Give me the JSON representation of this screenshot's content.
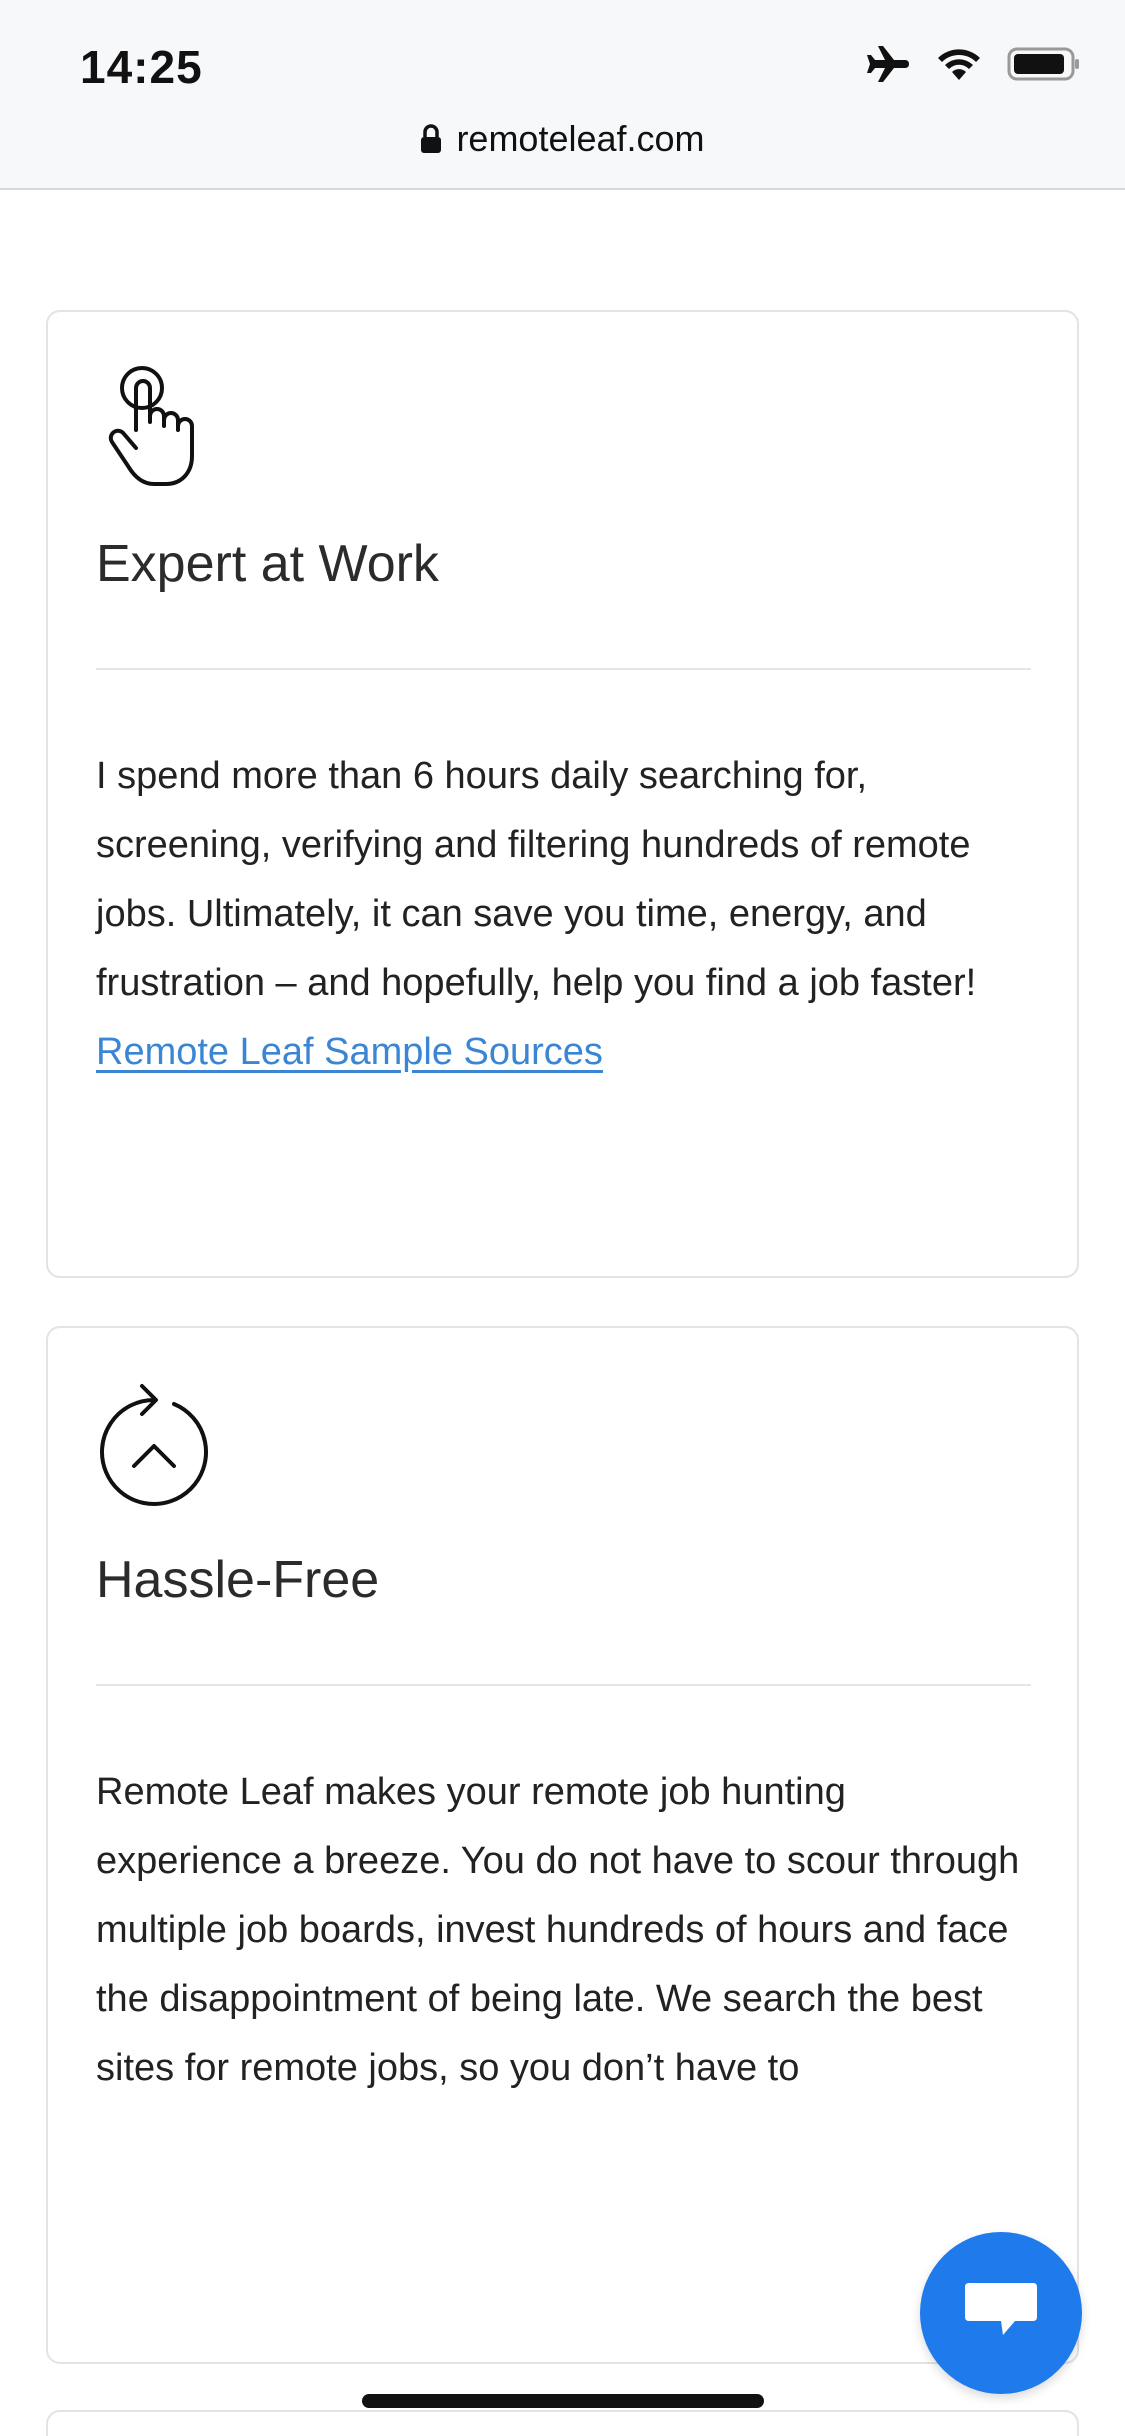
{
  "status_bar": {
    "time": "14:25",
    "icons": [
      "airplane-icon",
      "wifi-icon",
      "battery-icon"
    ]
  },
  "url_bar": {
    "domain": "remoteleaf.com",
    "icon": "lock-icon"
  },
  "cards": [
    {
      "icon": "pointer-hand-icon",
      "title": "Expert at Work",
      "body": "I spend more than 6 hours daily searching for, screening, verifying and filtering hundreds of remote jobs. Ultimately, it can save you time, energy, and frustration – and hopefully, help you find a job faster! ",
      "link_text": "Remote Leaf Sample Sources"
    },
    {
      "icon": "refresh-circle-icon",
      "title": "Hassle-Free",
      "body": "Remote Leaf makes your remote job hunting experience a breeze. You do not have to scour through multiple job boards, invest hundreds of hours and face the disappointment of being late. We search the best sites for remote jobs, so you don’t have to"
    }
  ],
  "chat_button": {
    "icon": "chat-bubble-icon"
  },
  "colors": {
    "link": "#3b86d4",
    "chat_button": "#1f7aec",
    "card_border": "#e3e3e3"
  }
}
